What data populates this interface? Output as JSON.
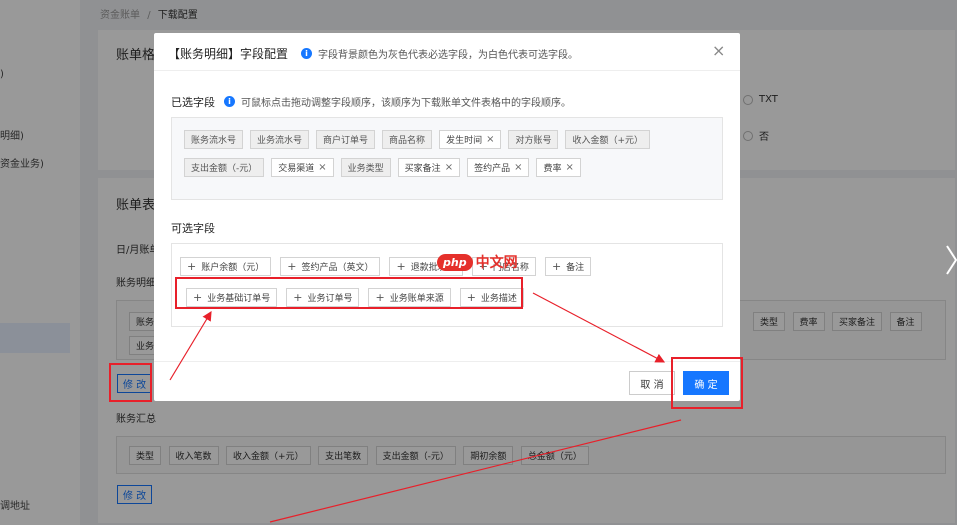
{
  "breadcrumb": {
    "parent": "资金账单",
    "sep": "/",
    "current": "下载配置"
  },
  "sidebar": {
    "item1": ")",
    "item2": "明细)",
    "item3": "资金业务)",
    "item4": "调地址"
  },
  "background": {
    "card1_title": "账单格",
    "card2_title": "账单表",
    "radio_txt": "TXT",
    "radio_no": "否",
    "label_daily": "日/月账单",
    "label_detail": "账务明细",
    "detail_tags_right": [
      "类型",
      "费率",
      "买家备注",
      "备注"
    ],
    "detail_tags_left": [
      "账务",
      "业务"
    ],
    "modify_label": "修 改",
    "summary_title": "账务汇总",
    "summary_tags": [
      "类型",
      "收入笔数",
      "收入金额（+元）",
      "支出笔数",
      "支出金额（-元）",
      "期初余额",
      "总金额（元）"
    ],
    "modify_label2": "修 改"
  },
  "dialog": {
    "title": "【账务明细】字段配置",
    "tip": "字段背景颜色为灰色代表必选字段，为白色代表可选字段。",
    "close": "×",
    "selected_title": "已选字段",
    "selected_tip": "可鼠标点击拖动调整字段顺序，该顺序为下载账单文件表格中的字段顺序。",
    "selected_row1": [
      {
        "label": "账务流水号",
        "removable": false
      },
      {
        "label": "业务流水号",
        "removable": false
      },
      {
        "label": "商户订单号",
        "removable": false
      },
      {
        "label": "商品名称",
        "removable": false
      },
      {
        "label": "发生时间",
        "removable": true
      },
      {
        "label": "对方账号",
        "removable": false
      },
      {
        "label": "收入金额（+元）",
        "removable": false
      }
    ],
    "selected_row2": [
      {
        "label": "支出金额（-元）",
        "removable": false
      },
      {
        "label": "交易渠道",
        "removable": true
      },
      {
        "label": "业务类型",
        "removable": false
      },
      {
        "label": "买家备注",
        "removable": true
      },
      {
        "label": "签约产品",
        "removable": true
      },
      {
        "label": "费率",
        "removable": true
      }
    ],
    "optional_title": "可选字段",
    "optional_row1": [
      "账户余额（元）",
      "签约产品（英文）",
      "退款批次号",
      "门店名称",
      "备注"
    ],
    "optional_row2": [
      "业务基础订单号",
      "业务订单号",
      "业务账单来源",
      "业务描述"
    ],
    "cancel": "取 消",
    "ok": "确 定"
  },
  "watermark": {
    "badge": "php",
    "text": "中文网"
  },
  "colors": {
    "primary": "#1677ff",
    "annotation": "#e8202a",
    "watermark": "#e5302b"
  }
}
